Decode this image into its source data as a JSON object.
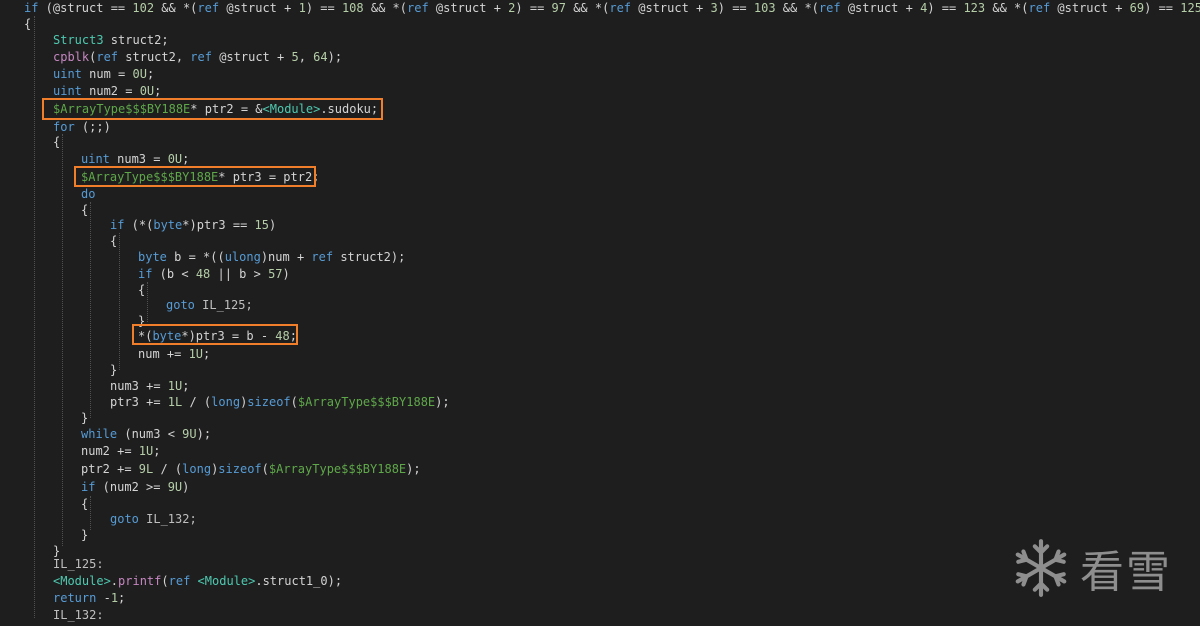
{
  "editor": {
    "lines": [
      [
        {
          "t": "if",
          "c": "keyword"
        },
        {
          "t": " (@struct == ",
          "c": "default"
        },
        {
          "t": "102",
          "c": "number"
        },
        {
          "t": " && *(",
          "c": "default"
        },
        {
          "t": "ref",
          "c": "keyword"
        },
        {
          "t": " @struct + ",
          "c": "default"
        },
        {
          "t": "1",
          "c": "number"
        },
        {
          "t": ") == ",
          "c": "default"
        },
        {
          "t": "108",
          "c": "number"
        },
        {
          "t": " && *(",
          "c": "default"
        },
        {
          "t": "ref",
          "c": "keyword"
        },
        {
          "t": " @struct + ",
          "c": "default"
        },
        {
          "t": "2",
          "c": "number"
        },
        {
          "t": ") == ",
          "c": "default"
        },
        {
          "t": "97",
          "c": "number"
        },
        {
          "t": " && *(",
          "c": "default"
        },
        {
          "t": "ref",
          "c": "keyword"
        },
        {
          "t": " @struct + ",
          "c": "default"
        },
        {
          "t": "3",
          "c": "number"
        },
        {
          "t": ") == ",
          "c": "default"
        },
        {
          "t": "103",
          "c": "number"
        },
        {
          "t": " && *(",
          "c": "default"
        },
        {
          "t": "ref",
          "c": "keyword"
        },
        {
          "t": " @struct + ",
          "c": "default"
        },
        {
          "t": "4",
          "c": "number"
        },
        {
          "t": ") == ",
          "c": "default"
        },
        {
          "t": "123",
          "c": "number"
        },
        {
          "t": " && *(",
          "c": "default"
        },
        {
          "t": "ref",
          "c": "keyword"
        },
        {
          "t": " @struct + ",
          "c": "default"
        },
        {
          "t": "69",
          "c": "number"
        },
        {
          "t": ") == ",
          "c": "default"
        },
        {
          "t": "125",
          "c": "number"
        },
        {
          "t": ")",
          "c": "default"
        }
      ],
      [
        {
          "t": "{",
          "c": "default"
        }
      ],
      [
        {
          "t": "Struct3",
          "c": "type"
        },
        {
          "t": " struct2;",
          "c": "default"
        }
      ],
      [
        {
          "t": "cpblk",
          "c": "func"
        },
        {
          "t": "(",
          "c": "default"
        },
        {
          "t": "ref",
          "c": "keyword"
        },
        {
          "t": " struct2, ",
          "c": "default"
        },
        {
          "t": "ref",
          "c": "keyword"
        },
        {
          "t": " @struct + ",
          "c": "default"
        },
        {
          "t": "5",
          "c": "number"
        },
        {
          "t": ", ",
          "c": "default"
        },
        {
          "t": "64",
          "c": "number"
        },
        {
          "t": ");",
          "c": "default"
        }
      ],
      [
        {
          "t": "uint",
          "c": "keyword"
        },
        {
          "t": " num = ",
          "c": "default"
        },
        {
          "t": "0U",
          "c": "number"
        },
        {
          "t": ";",
          "c": "default"
        }
      ],
      [
        {
          "t": "uint",
          "c": "keyword"
        },
        {
          "t": " num2 = ",
          "c": "default"
        },
        {
          "t": "0U",
          "c": "number"
        },
        {
          "t": ";",
          "c": "default"
        }
      ],
      [
        {
          "t": "$ArrayType$$$BY188E",
          "c": "green"
        },
        {
          "t": "* ptr2 = &",
          "c": "default"
        },
        {
          "t": "<Module>",
          "c": "type"
        },
        {
          "t": ".sudoku;",
          "c": "default"
        }
      ],
      [
        {
          "t": "for",
          "c": "keyword"
        },
        {
          "t": " (;;)",
          "c": "default"
        }
      ],
      [
        {
          "t": "{",
          "c": "default"
        }
      ],
      [
        {
          "t": "uint",
          "c": "keyword"
        },
        {
          "t": " num3 = ",
          "c": "default"
        },
        {
          "t": "0U",
          "c": "number"
        },
        {
          "t": ";",
          "c": "default"
        }
      ],
      [
        {
          "t": "$ArrayType$$$BY188E",
          "c": "green"
        },
        {
          "t": "* ptr3 = ptr2;",
          "c": "default"
        }
      ],
      [
        {
          "t": "do",
          "c": "keyword"
        }
      ],
      [
        {
          "t": "{",
          "c": "default"
        }
      ],
      [
        {
          "t": "if",
          "c": "keyword"
        },
        {
          "t": " (*(",
          "c": "default"
        },
        {
          "t": "byte",
          "c": "keyword"
        },
        {
          "t": "*)ptr3 == ",
          "c": "default"
        },
        {
          "t": "15",
          "c": "number"
        },
        {
          "t": ")",
          "c": "default"
        }
      ],
      [
        {
          "t": "{",
          "c": "default"
        }
      ],
      [
        {
          "t": "byte",
          "c": "keyword"
        },
        {
          "t": " b = *((",
          "c": "default"
        },
        {
          "t": "ulong",
          "c": "keyword"
        },
        {
          "t": ")num + ",
          "c": "default"
        },
        {
          "t": "ref",
          "c": "keyword"
        },
        {
          "t": " struct2);",
          "c": "default"
        }
      ],
      [
        {
          "t": "if",
          "c": "keyword"
        },
        {
          "t": " (b < ",
          "c": "default"
        },
        {
          "t": "48",
          "c": "number"
        },
        {
          "t": " || b > ",
          "c": "default"
        },
        {
          "t": "57",
          "c": "number"
        },
        {
          "t": ")",
          "c": "default"
        }
      ],
      [
        {
          "t": "{",
          "c": "default"
        }
      ],
      [
        {
          "t": "goto",
          "c": "keyword"
        },
        {
          "t": " IL_125;",
          "c": "label"
        }
      ],
      [
        {
          "t": "}",
          "c": "default"
        }
      ],
      [
        {
          "t": "*(",
          "c": "default"
        },
        {
          "t": "byte",
          "c": "keyword"
        },
        {
          "t": "*)ptr3 = b - ",
          "c": "default"
        },
        {
          "t": "48",
          "c": "number"
        },
        {
          "t": ";",
          "c": "default"
        }
      ],
      [
        {
          "t": "num += ",
          "c": "default"
        },
        {
          "t": "1U",
          "c": "number"
        },
        {
          "t": ";",
          "c": "default"
        }
      ],
      [
        {
          "t": "}",
          "c": "default"
        }
      ],
      [
        {
          "t": "num3 += ",
          "c": "default"
        },
        {
          "t": "1U",
          "c": "number"
        },
        {
          "t": ";",
          "c": "default"
        }
      ],
      [
        {
          "t": "ptr3 += ",
          "c": "default"
        },
        {
          "t": "1L",
          "c": "number"
        },
        {
          "t": " / (",
          "c": "default"
        },
        {
          "t": "long",
          "c": "keyword"
        },
        {
          "t": ")",
          "c": "default"
        },
        {
          "t": "sizeof",
          "c": "keyword"
        },
        {
          "t": "(",
          "c": "default"
        },
        {
          "t": "$ArrayType$$$BY188E",
          "c": "green"
        },
        {
          "t": ");",
          "c": "default"
        }
      ],
      [
        {
          "t": "}",
          "c": "default"
        }
      ],
      [
        {
          "t": "while",
          "c": "keyword"
        },
        {
          "t": " (num3 < ",
          "c": "default"
        },
        {
          "t": "9U",
          "c": "number"
        },
        {
          "t": ");",
          "c": "default"
        }
      ],
      [
        {
          "t": "num2 += ",
          "c": "default"
        },
        {
          "t": "1U",
          "c": "number"
        },
        {
          "t": ";",
          "c": "default"
        }
      ],
      [
        {
          "t": "ptr2 += ",
          "c": "default"
        },
        {
          "t": "9L",
          "c": "number"
        },
        {
          "t": " / (",
          "c": "default"
        },
        {
          "t": "long",
          "c": "keyword"
        },
        {
          "t": ")",
          "c": "default"
        },
        {
          "t": "sizeof",
          "c": "keyword"
        },
        {
          "t": "(",
          "c": "default"
        },
        {
          "t": "$ArrayType$$$BY188E",
          "c": "green"
        },
        {
          "t": ");",
          "c": "default"
        }
      ],
      [
        {
          "t": "if",
          "c": "keyword"
        },
        {
          "t": " (num2 >= ",
          "c": "default"
        },
        {
          "t": "9U",
          "c": "number"
        },
        {
          "t": ")",
          "c": "default"
        }
      ],
      [
        {
          "t": "{",
          "c": "default"
        }
      ],
      [
        {
          "t": "goto",
          "c": "keyword"
        },
        {
          "t": " IL_132;",
          "c": "label"
        }
      ],
      [
        {
          "t": "}",
          "c": "default"
        }
      ],
      [
        {
          "t": "}",
          "c": "default"
        }
      ],
      [
        {
          "t": "IL_125:",
          "c": "label"
        }
      ],
      [
        {
          "t": "<Module>",
          "c": "type"
        },
        {
          "t": ".",
          "c": "default"
        },
        {
          "t": "printf",
          "c": "func"
        },
        {
          "t": "(",
          "c": "default"
        },
        {
          "t": "ref",
          "c": "keyword"
        },
        {
          "t": " ",
          "c": "default"
        },
        {
          "t": "<Module>",
          "c": "type"
        },
        {
          "t": ".struct1_0);",
          "c": "default"
        }
      ],
      [
        {
          "t": "return",
          "c": "keyword"
        },
        {
          "t": " -",
          "c": "default"
        },
        {
          "t": "1",
          "c": "number"
        },
        {
          "t": ";",
          "c": "default"
        }
      ],
      [
        {
          "t": "IL_132:",
          "c": "label"
        }
      ]
    ]
  },
  "highlights": [
    "ptr2-declaration",
    "ptr3-declaration",
    "ptr3-assignment"
  ],
  "colors": {
    "background": "#1e1e1e",
    "highlight_border": "#f07e2a",
    "keyword": "#569cd6",
    "type": "#4ec9b0",
    "array_type": "#5fa84a",
    "number": "#b5cea8",
    "function": "#c586c0"
  },
  "watermark": {
    "icon": "snowflake-icon",
    "text": "看雪"
  }
}
